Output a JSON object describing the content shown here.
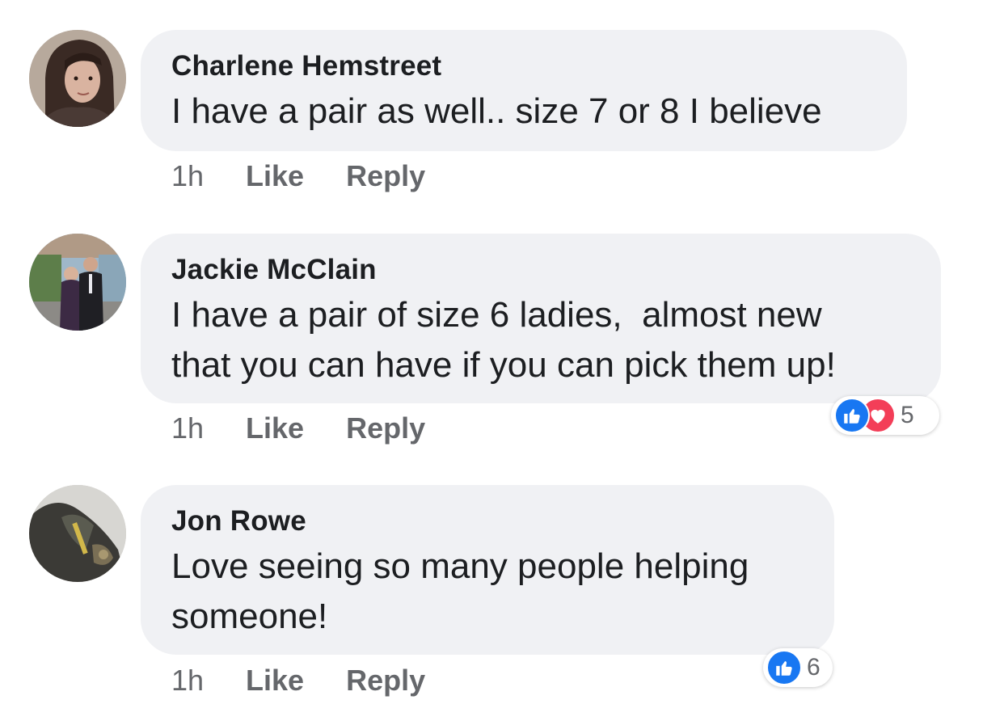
{
  "comments": [
    {
      "author": "Charlene Hemstreet",
      "text": "I have a pair as well.. size 7 or 8 I believe",
      "time": "1h",
      "like_label": "Like",
      "reply_label": "Reply"
    },
    {
      "author": "Jackie McClain",
      "text": "I have a pair of size 6 ladies,  almost new\nthat you can have if you can pick them up!",
      "time": "1h",
      "like_label": "Like",
      "reply_label": "Reply",
      "reactions": {
        "types": [
          "like-icon",
          "love-icon"
        ],
        "count": "5"
      }
    },
    {
      "author": "Jon Rowe",
      "text": "Love seeing so many people helping\nsomeone!",
      "time": "1h",
      "like_label": "Like",
      "reply_label": "Reply",
      "reactions": {
        "types": [
          "like-icon"
        ],
        "count": "6"
      }
    }
  ],
  "colors": {
    "bubble": "#f0f1f4",
    "like": "#1877f2",
    "love": "#f33e58",
    "meta_text": "#65676b"
  }
}
